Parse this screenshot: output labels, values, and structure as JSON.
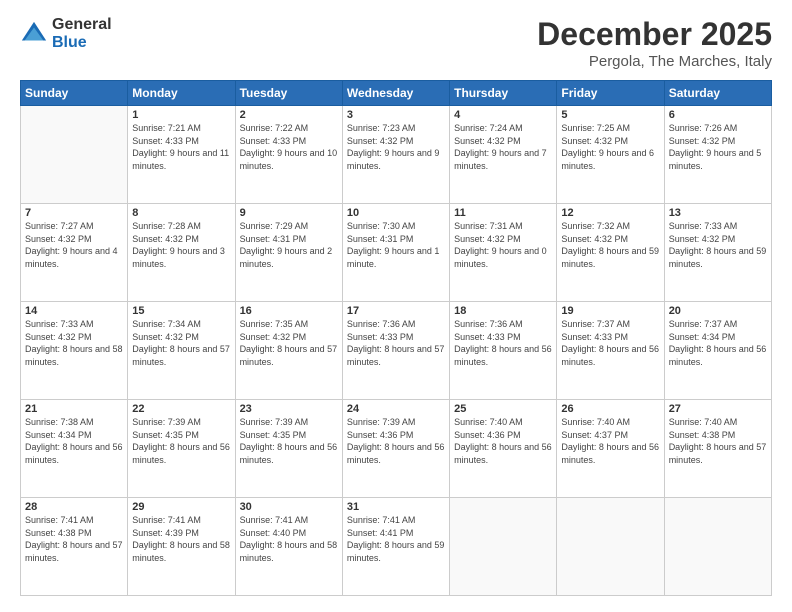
{
  "logo": {
    "text1": "General",
    "text2": "Blue"
  },
  "header": {
    "month": "December 2025",
    "location": "Pergola, The Marches, Italy"
  },
  "days": [
    "Sunday",
    "Monday",
    "Tuesday",
    "Wednesday",
    "Thursday",
    "Friday",
    "Saturday"
  ],
  "weeks": [
    [
      {
        "day": "",
        "sunrise": "",
        "sunset": "",
        "daylight": ""
      },
      {
        "day": "1",
        "sunrise": "Sunrise: 7:21 AM",
        "sunset": "Sunset: 4:33 PM",
        "daylight": "Daylight: 9 hours and 11 minutes."
      },
      {
        "day": "2",
        "sunrise": "Sunrise: 7:22 AM",
        "sunset": "Sunset: 4:33 PM",
        "daylight": "Daylight: 9 hours and 10 minutes."
      },
      {
        "day": "3",
        "sunrise": "Sunrise: 7:23 AM",
        "sunset": "Sunset: 4:32 PM",
        "daylight": "Daylight: 9 hours and 9 minutes."
      },
      {
        "day": "4",
        "sunrise": "Sunrise: 7:24 AM",
        "sunset": "Sunset: 4:32 PM",
        "daylight": "Daylight: 9 hours and 7 minutes."
      },
      {
        "day": "5",
        "sunrise": "Sunrise: 7:25 AM",
        "sunset": "Sunset: 4:32 PM",
        "daylight": "Daylight: 9 hours and 6 minutes."
      },
      {
        "day": "6",
        "sunrise": "Sunrise: 7:26 AM",
        "sunset": "Sunset: 4:32 PM",
        "daylight": "Daylight: 9 hours and 5 minutes."
      }
    ],
    [
      {
        "day": "7",
        "sunrise": "Sunrise: 7:27 AM",
        "sunset": "Sunset: 4:32 PM",
        "daylight": "Daylight: 9 hours and 4 minutes."
      },
      {
        "day": "8",
        "sunrise": "Sunrise: 7:28 AM",
        "sunset": "Sunset: 4:32 PM",
        "daylight": "Daylight: 9 hours and 3 minutes."
      },
      {
        "day": "9",
        "sunrise": "Sunrise: 7:29 AM",
        "sunset": "Sunset: 4:31 PM",
        "daylight": "Daylight: 9 hours and 2 minutes."
      },
      {
        "day": "10",
        "sunrise": "Sunrise: 7:30 AM",
        "sunset": "Sunset: 4:31 PM",
        "daylight": "Daylight: 9 hours and 1 minute."
      },
      {
        "day": "11",
        "sunrise": "Sunrise: 7:31 AM",
        "sunset": "Sunset: 4:32 PM",
        "daylight": "Daylight: 9 hours and 0 minutes."
      },
      {
        "day": "12",
        "sunrise": "Sunrise: 7:32 AM",
        "sunset": "Sunset: 4:32 PM",
        "daylight": "Daylight: 8 hours and 59 minutes."
      },
      {
        "day": "13",
        "sunrise": "Sunrise: 7:33 AM",
        "sunset": "Sunset: 4:32 PM",
        "daylight": "Daylight: 8 hours and 59 minutes."
      }
    ],
    [
      {
        "day": "14",
        "sunrise": "Sunrise: 7:33 AM",
        "sunset": "Sunset: 4:32 PM",
        "daylight": "Daylight: 8 hours and 58 minutes."
      },
      {
        "day": "15",
        "sunrise": "Sunrise: 7:34 AM",
        "sunset": "Sunset: 4:32 PM",
        "daylight": "Daylight: 8 hours and 57 minutes."
      },
      {
        "day": "16",
        "sunrise": "Sunrise: 7:35 AM",
        "sunset": "Sunset: 4:32 PM",
        "daylight": "Daylight: 8 hours and 57 minutes."
      },
      {
        "day": "17",
        "sunrise": "Sunrise: 7:36 AM",
        "sunset": "Sunset: 4:33 PM",
        "daylight": "Daylight: 8 hours and 57 minutes."
      },
      {
        "day": "18",
        "sunrise": "Sunrise: 7:36 AM",
        "sunset": "Sunset: 4:33 PM",
        "daylight": "Daylight: 8 hours and 56 minutes."
      },
      {
        "day": "19",
        "sunrise": "Sunrise: 7:37 AM",
        "sunset": "Sunset: 4:33 PM",
        "daylight": "Daylight: 8 hours and 56 minutes."
      },
      {
        "day": "20",
        "sunrise": "Sunrise: 7:37 AM",
        "sunset": "Sunset: 4:34 PM",
        "daylight": "Daylight: 8 hours and 56 minutes."
      }
    ],
    [
      {
        "day": "21",
        "sunrise": "Sunrise: 7:38 AM",
        "sunset": "Sunset: 4:34 PM",
        "daylight": "Daylight: 8 hours and 56 minutes."
      },
      {
        "day": "22",
        "sunrise": "Sunrise: 7:39 AM",
        "sunset": "Sunset: 4:35 PM",
        "daylight": "Daylight: 8 hours and 56 minutes."
      },
      {
        "day": "23",
        "sunrise": "Sunrise: 7:39 AM",
        "sunset": "Sunset: 4:35 PM",
        "daylight": "Daylight: 8 hours and 56 minutes."
      },
      {
        "day": "24",
        "sunrise": "Sunrise: 7:39 AM",
        "sunset": "Sunset: 4:36 PM",
        "daylight": "Daylight: 8 hours and 56 minutes."
      },
      {
        "day": "25",
        "sunrise": "Sunrise: 7:40 AM",
        "sunset": "Sunset: 4:36 PM",
        "daylight": "Daylight: 8 hours and 56 minutes."
      },
      {
        "day": "26",
        "sunrise": "Sunrise: 7:40 AM",
        "sunset": "Sunset: 4:37 PM",
        "daylight": "Daylight: 8 hours and 56 minutes."
      },
      {
        "day": "27",
        "sunrise": "Sunrise: 7:40 AM",
        "sunset": "Sunset: 4:38 PM",
        "daylight": "Daylight: 8 hours and 57 minutes."
      }
    ],
    [
      {
        "day": "28",
        "sunrise": "Sunrise: 7:41 AM",
        "sunset": "Sunset: 4:38 PM",
        "daylight": "Daylight: 8 hours and 57 minutes."
      },
      {
        "day": "29",
        "sunrise": "Sunrise: 7:41 AM",
        "sunset": "Sunset: 4:39 PM",
        "daylight": "Daylight: 8 hours and 58 minutes."
      },
      {
        "day": "30",
        "sunrise": "Sunrise: 7:41 AM",
        "sunset": "Sunset: 4:40 PM",
        "daylight": "Daylight: 8 hours and 58 minutes."
      },
      {
        "day": "31",
        "sunrise": "Sunrise: 7:41 AM",
        "sunset": "Sunset: 4:41 PM",
        "daylight": "Daylight: 8 hours and 59 minutes."
      },
      {
        "day": "",
        "sunrise": "",
        "sunset": "",
        "daylight": ""
      },
      {
        "day": "",
        "sunrise": "",
        "sunset": "",
        "daylight": ""
      },
      {
        "day": "",
        "sunrise": "",
        "sunset": "",
        "daylight": ""
      }
    ]
  ]
}
